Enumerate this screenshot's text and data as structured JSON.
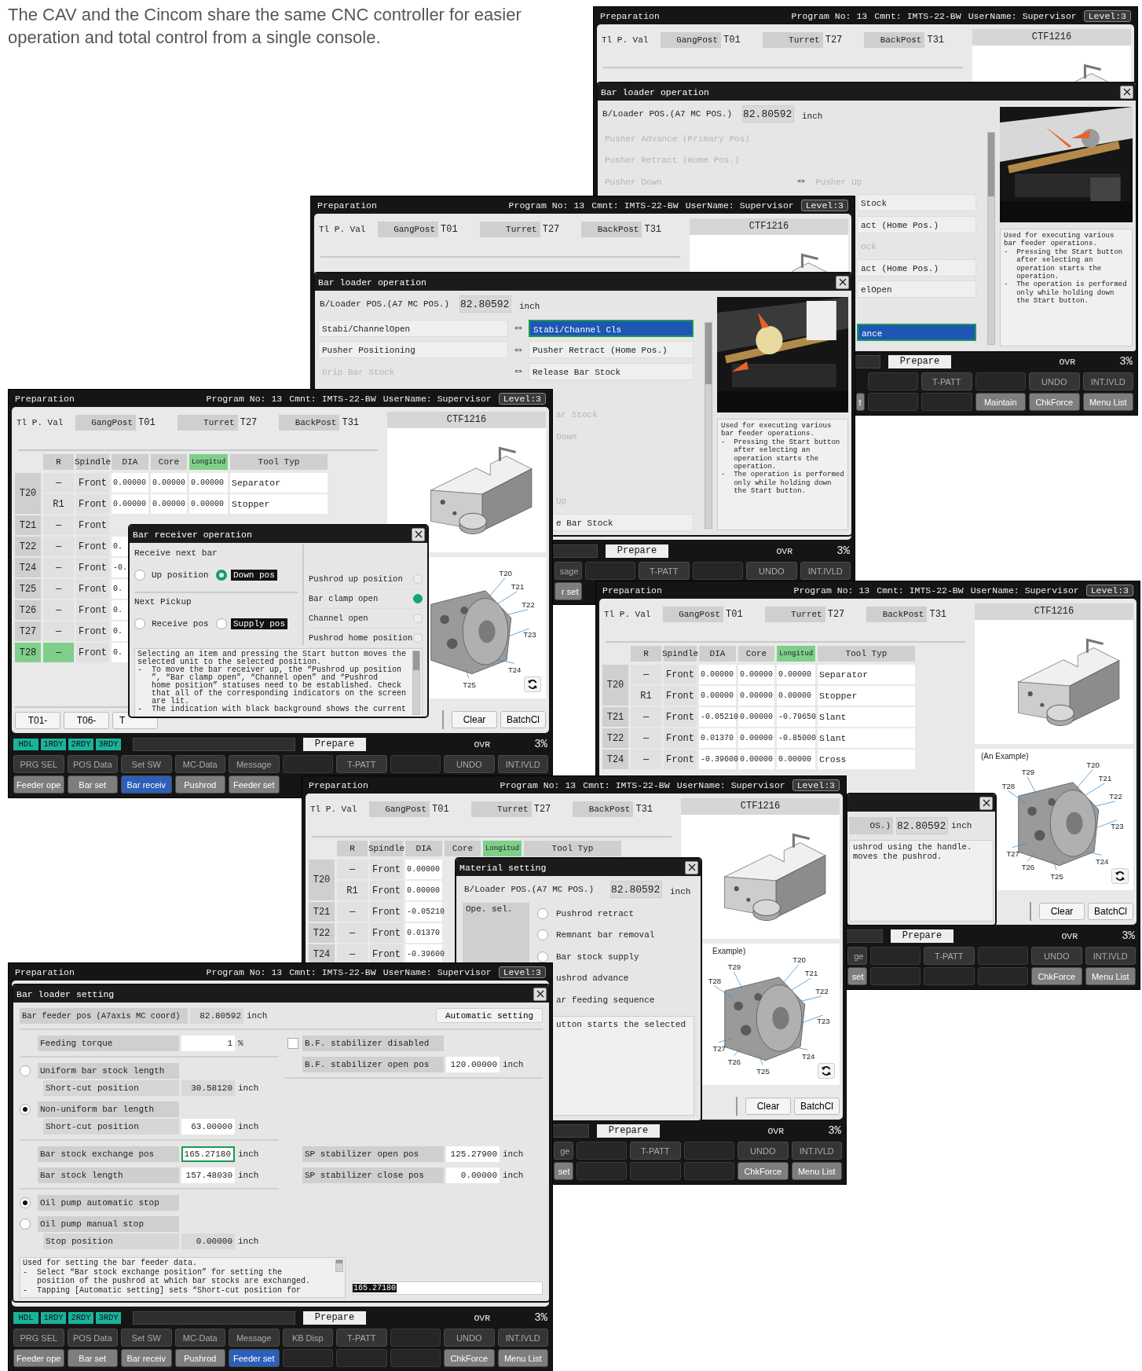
{
  "caption": "The CAV and the Cincom share the same CNC controller for easier operation and total control from a single console.",
  "windows": [
    {
      "header": {
        "title": "Preparation",
        "program": "Program No: 13",
        "comment": "Cmnt: IMTS-22-BW",
        "user": "UserName: Supervisor",
        "level": "Level:3"
      },
      "tabs_label": "Tl P. Val",
      "tabs": [
        {
          "label": "GangPost",
          "value": "T01"
        },
        {
          "label": "Turret",
          "value": "T27"
        },
        {
          "label": "BackPost",
          "value": "T31"
        }
      ],
      "side_panel": {
        "title": "CTF1216"
      },
      "dialog": {
        "kind": "operation",
        "title": "Bar loader operation",
        "position": {
          "label": "B/Loader POS.(A7 MC POS.)",
          "value": "82.80592",
          "unit": "inch"
        },
        "rows": [
          {
            "left": {
              "text": "Pusher Advance (Primary Pos)",
              "selected": false,
              "disabled": true
            }
          },
          {
            "left": {
              "text": "Pusher Retract (Home Pos.)",
              "selected": false,
              "disabled": true
            }
          },
          {
            "left": {
              "text": "Pusher Down",
              "selected": false,
              "disabled": true
            },
            "arrow": "⇔",
            "right": {
              "text": "Pusher Up",
              "selected": false,
              "disabled": true
            }
          },
          {
            "right": {
              "text": "Stock",
              "selected": false,
              "disabled": false
            }
          },
          {
            "right": {
              "text": "act (Home Pos.)",
              "selected": false,
              "disabled": false
            }
          },
          {
            "right": {
              "text": "ock",
              "selected": false,
              "disabled": true
            }
          },
          {
            "right": {
              "text": "act (Home Pos.)",
              "selected": false,
              "disabled": false
            }
          },
          {
            "right": {
              "text": "elOpen",
              "selected": false,
              "disabled": false
            }
          },
          {
            "right": {
              "text": "ance",
              "selected": true,
              "disabled": false
            }
          }
        ],
        "help": "Used for executing various\nbar feeder operations.\n-  Pressing the Start button\n   after selecting an\n   operation starts the\n   operation.\n-  The operation is performed\n   only while holding down\n   the Start button."
      },
      "status": {
        "button": "Prepare",
        "ovr": "OVR",
        "percent": "3%"
      },
      "function_keys": [
        [
          {
            "kind": "blank",
            "selected": false
          },
          {
            "kind": "key",
            "label": "T-PATT",
            "selected": false
          },
          {
            "kind": "blank",
            "selected": false
          },
          {
            "kind": "key",
            "label": "UNDO",
            "selected": false
          },
          {
            "kind": "key",
            "label": "INT.IVLD",
            "selected": false
          }
        ],
        [
          {
            "kind": "cut",
            "label": "t",
            "selected": false
          },
          {
            "kind": "blank",
            "selected": false
          },
          {
            "kind": "blank",
            "selected": false
          },
          {
            "kind": "key",
            "label": "Maintain",
            "selected": false
          },
          {
            "kind": "key",
            "label": "ChkForce",
            "selected": false
          },
          {
            "kind": "key",
            "label": "Menu List",
            "selected": false
          }
        ]
      ]
    },
    {
      "header": {
        "title": "Preparation",
        "program": "Program No: 13",
        "comment": "Cmnt: IMTS-22-BW",
        "user": "UserName: Supervisor",
        "level": "Level:3"
      },
      "tabs_label": "Tl P. Val",
      "tabs": [
        {
          "label": "GangPost",
          "value": "T01"
        },
        {
          "label": "Turret",
          "value": "T27"
        },
        {
          "label": "BackPost",
          "value": "T31"
        }
      ],
      "side_panel": {
        "title": "CTF1216"
      },
      "dialog": {
        "kind": "operation",
        "title": "Bar loader operation",
        "position": {
          "label": "B/Loader POS.(A7 MC POS.)",
          "value": "82.80592",
          "unit": "inch"
        },
        "rows": [
          {
            "left": {
              "text": "Stabi/ChannelOpen",
              "selected": false,
              "disabled": false
            },
            "arrow": "⇔",
            "right": {
              "text": "Stabi/Channel Cls",
              "selected": true,
              "disabled": false
            }
          },
          {
            "left": {
              "text": "Pusher Positioning",
              "selected": false,
              "disabled": false
            },
            "arrow": "⇔",
            "right": {
              "text": "Pusher Retract (Home Pos.)",
              "selected": false,
              "disabled": false
            }
          },
          {
            "left": {
              "text": "Grip Bar Stock",
              "selected": false,
              "disabled": true
            },
            "arrow": "⇔",
            "right": {
              "text": "Release Bar Stock",
              "selected": false,
              "disabled": false
            }
          },
          {
            "right": {
              "text": "ar Stock",
              "selected": false,
              "disabled": true
            }
          },
          {
            "right": {
              "text": "Down",
              "selected": false,
              "disabled": true
            }
          },
          {
            "right": {
              "text": "Up",
              "selected": false,
              "disabled": true
            }
          },
          {
            "right": {
              "text": "e Bar Stock",
              "selected": false,
              "disabled": false
            }
          }
        ],
        "help": "Used for executing various\nbar feeder operations.\n-  Pressing the Start button\n   after selecting an\n   operation starts the\n   operation.\n-  The operation is performed\n   only while holding down\n   the Start button."
      },
      "status": {
        "button": "Prepare",
        "ovr": "OVR",
        "percent": "3%"
      },
      "function_keys": [
        [
          {
            "kind": "cut",
            "label": "sage",
            "selected": false
          },
          {
            "kind": "blank",
            "selected": false
          },
          {
            "kind": "key",
            "label": "T-PATT",
            "selected": false
          },
          {
            "kind": "blank",
            "selected": false
          },
          {
            "kind": "key",
            "label": "UNDO",
            "selected": false
          },
          {
            "kind": "key",
            "label": "INT.IVLD",
            "selected": false
          }
        ],
        [
          {
            "kind": "cut",
            "label": "r set",
            "selected": false
          }
        ]
      ]
    },
    {
      "header": {
        "title": "Preparation",
        "program": "Program No: 13",
        "comment": "Cmnt: IMTS-22-BW",
        "user": "UserName: Supervisor",
        "level": "Level:3"
      },
      "tabs_label": "Tl P. Val",
      "tabs": [
        {
          "label": "GangPost",
          "value": "T01"
        },
        {
          "label": "Turret",
          "value": "T27"
        },
        {
          "label": "BackPost",
          "value": "T31"
        }
      ],
      "table": {
        "columns": [
          {
            "label": "R",
            "selected": false
          },
          {
            "label": "Spindle",
            "selected": false
          },
          {
            "label": "DIA",
            "selected": false
          },
          {
            "label": "Core",
            "selected": false
          },
          {
            "label": "Longitud",
            "selected": true
          },
          {
            "label": "Tool Typ",
            "selected": false
          }
        ],
        "groups": [
          {
            "tool": "T20",
            "selected": false,
            "rows": [
              {
                "cells": [
                  "—",
                  "Front",
                  "0.00000",
                  "0.00000",
                  "0.00000",
                  "Separator"
                ]
              },
              {
                "cells": [
                  "R1",
                  "Front",
                  "0.00000",
                  "0.00000",
                  "0.00000",
                  "Stopper"
                ]
              }
            ]
          },
          {
            "tool": "T21",
            "selected": false,
            "rows": [
              {
                "cells": [
                  "—",
                  "Front"
                ]
              }
            ]
          },
          {
            "tool": "T22",
            "selected": false,
            "rows": [
              {
                "cells": [
                  "—",
                  "Front",
                  "0."
                ]
              }
            ]
          },
          {
            "tool": "T24",
            "selected": false,
            "rows": [
              {
                "cells": [
                  "—",
                  "Front",
                  "-0."
                ]
              }
            ]
          },
          {
            "tool": "T25",
            "selected": false,
            "rows": [
              {
                "cells": [
                  "—",
                  "Front",
                  "0."
                ]
              }
            ]
          },
          {
            "tool": "T26",
            "selected": false,
            "rows": [
              {
                "cells": [
                  "—",
                  "Front",
                  "0."
                ]
              }
            ]
          },
          {
            "tool": "T27",
            "selected": false,
            "rows": [
              {
                "cells": [
                  "—",
                  "Front",
                  "0."
                ]
              }
            ]
          },
          {
            "tool": "T28",
            "selected": true,
            "rows": [
              {
                "cells": [
                  "—",
                  "Front",
                  "0."
                ]
              }
            ]
          }
        ]
      },
      "main_buttons": [
        {
          "kind": "key",
          "label": "T01-"
        },
        {
          "kind": "key",
          "label": "T06-"
        },
        {
          "kind": "cut",
          "label": "T"
        }
      ],
      "side_panel": {
        "title": "CTF1216",
        "turret": {
          "labels": [
            "T20",
            "T21",
            "T22",
            "T23",
            "T24",
            "T25"
          ]
        },
        "buttons": [
          "Clear",
          "BatchCl"
        ]
      },
      "dialog": {
        "kind": "receiver",
        "title": "Bar receiver operation",
        "groups": [
          {
            "title": "Receive next bar",
            "options": [
              {
                "label": "Up position",
                "selected": false,
                "current": false
              },
              {
                "label": "Down pos",
                "selected": true,
                "current": true
              }
            ]
          },
          {
            "title": "Next Pickup",
            "options": [
              {
                "label": "Receive pos",
                "selected": false,
                "current": false
              },
              {
                "label": "Supply pos",
                "selected": false,
                "current": true
              }
            ]
          }
        ],
        "indicators": [
          {
            "label": "Pushrod up position",
            "on": false
          },
          {
            "label": "Bar clamp open",
            "on": true
          },
          {
            "label": "Channel open",
            "on": false
          },
          {
            "label": "Pushrod home position",
            "on": false
          }
        ],
        "help": "Selecting an item and pressing the Start button moves the\nselected unit to the selected position.\n-  To move the bar receiver up, the “Pushrod up position\n   ”, “Bar clamp open”, “Channel open” and “Pushrod\n   home position” statuses need to be established. Check\n   that all of the corresponding indicators on the screen\n   are lit.\n-  The indication with black background shows the current"
      },
      "status": {
        "chips": [
          {
            "label": "HDL",
            "on": true
          },
          {
            "label": "1RDY",
            "on": true
          },
          {
            "label": "2RDY",
            "on": true
          },
          {
            "label": "3RDY",
            "on": true
          }
        ],
        "button": "Prepare",
        "ovr": "OVR",
        "percent": "3%"
      },
      "function_keys": [
        [
          {
            "kind": "key",
            "label": "PRG SEL",
            "selected": false
          },
          {
            "kind": "key",
            "label": "POS Data",
            "selected": false
          },
          {
            "kind": "key",
            "label": "Set SW",
            "selected": false
          },
          {
            "kind": "key",
            "label": "MC-Data",
            "selected": false
          },
          {
            "kind": "key",
            "label": "Message",
            "selected": false
          },
          {
            "kind": "blank",
            "selected": false
          },
          {
            "kind": "key",
            "label": "T-PATT",
            "selected": false
          },
          {
            "kind": "blank",
            "selected": false
          },
          {
            "kind": "key",
            "label": "UNDO",
            "selected": false
          },
          {
            "kind": "key",
            "label": "INT.IVLD",
            "selected": false
          }
        ],
        [
          {
            "kind": "key",
            "label": "Feeder ope",
            "selected": false
          },
          {
            "kind": "key",
            "label": "Bar set",
            "selected": false
          },
          {
            "kind": "key",
            "label": "Bar receiv",
            "selected": true
          },
          {
            "kind": "key",
            "label": "Pushrod",
            "selected": false
          },
          {
            "kind": "key",
            "label": "Feeder set",
            "selected": false
          }
        ]
      ]
    },
    {
      "header": {
        "title": "Preparation",
        "program": "Program No: 13",
        "comment": "Cmnt: IMTS-22-BW",
        "user": "UserName: Supervisor",
        "level": "Level:3"
      },
      "tabs_label": "Tl P. Val",
      "tabs": [
        {
          "label": "GangPost",
          "value": "T01"
        },
        {
          "label": "Turret",
          "value": "T27"
        },
        {
          "label": "BackPost",
          "value": "T31"
        }
      ],
      "table": {
        "columns": [
          {
            "label": "R",
            "selected": false
          },
          {
            "label": "Spindle",
            "selected": false
          },
          {
            "label": "DIA",
            "selected": false
          },
          {
            "label": "Core",
            "selected": false
          },
          {
            "label": "Longitud",
            "selected": true
          },
          {
            "label": "Tool Typ",
            "selected": false
          }
        ],
        "groups": [
          {
            "tool": "T20",
            "selected": false,
            "rows": [
              {
                "cells": [
                  "—",
                  "Front",
                  "0.00000",
                  "0.00000",
                  "0.00000",
                  "Separator"
                ]
              },
              {
                "cells": [
                  "R1",
                  "Front",
                  "0.00000",
                  "0.00000",
                  "0.00000",
                  "Stopper"
                ]
              }
            ]
          },
          {
            "tool": "T21",
            "selected": false,
            "rows": [
              {
                "cells": [
                  "—",
                  "Front",
                  "-0.05210",
                  "0.00000",
                  "-0.79650",
                  "Slant"
                ]
              }
            ]
          },
          {
            "tool": "T22",
            "selected": false,
            "rows": [
              {
                "cells": [
                  "—",
                  "Front",
                  "0.01370",
                  "0.00000",
                  "-0.85000",
                  "Slant"
                ]
              }
            ]
          },
          {
            "tool": "T24",
            "selected": false,
            "rows": [
              {
                "cells": [
                  "—",
                  "Front",
                  "-0.39600",
                  "0.00000",
                  "0.00000",
                  "Cross"
                ]
              }
            ]
          }
        ]
      },
      "side_panel": {
        "title": "CTF1216",
        "caption": "(An Example)",
        "turret": {
          "labels": [
            "T20",
            "T21",
            "T22",
            "T23",
            "T24",
            "T25",
            "T26",
            "T27",
            "T28",
            "T29"
          ]
        },
        "buttons": [
          "Clear",
          "BatchCl"
        ]
      },
      "dialog": {
        "kind": "fragment",
        "position": {
          "label": "OS.)",
          "value": "82.80592",
          "unit": "inch"
        },
        "help": "ushrod using the handle.\nmoves the pushrod."
      },
      "status": {
        "button": "Prepare",
        "ovr": "OVR",
        "percent": "3%"
      },
      "function_keys": [
        [
          {
            "kind": "cut",
            "label": "ge",
            "selected": false
          },
          {
            "kind": "blank",
            "selected": false
          },
          {
            "kind": "key",
            "label": "T-PATT",
            "selected": false
          },
          {
            "kind": "blank",
            "selected": false
          },
          {
            "kind": "key",
            "label": "UNDO",
            "selected": false
          },
          {
            "kind": "key",
            "label": "INT.IVLD",
            "selected": false
          }
        ],
        [
          {
            "kind": "cut",
            "label": "set",
            "selected": false
          },
          {
            "kind": "blank",
            "selected": false
          },
          {
            "kind": "blank",
            "selected": false
          },
          {
            "kind": "blank",
            "selected": false
          },
          {
            "kind": "key",
            "label": "ChkForce",
            "selected": false
          },
          {
            "kind": "key",
            "label": "Menu List",
            "selected": false
          }
        ]
      ]
    },
    {
      "header": {
        "title": "Preparation",
        "program": "Program No: 13",
        "comment": "Cmnt: IMTS-22-BW",
        "user": "UserName: Supervisor",
        "level": "Level:3"
      },
      "tabs_label": "Tl P. Val",
      "tabs": [
        {
          "label": "GangPost",
          "value": "T01"
        },
        {
          "label": "Turret",
          "value": "T27"
        },
        {
          "label": "BackPost",
          "value": "T31"
        }
      ],
      "table": {
        "columns": [
          {
            "label": "R",
            "selected": false
          },
          {
            "label": "Spindle",
            "selected": false
          },
          {
            "label": "DIA",
            "selected": false
          },
          {
            "label": "Core",
            "selected": false
          },
          {
            "label": "Longitud",
            "selected": true
          },
          {
            "label": "Tool Typ",
            "selected": false
          }
        ],
        "groups": [
          {
            "tool": "T20",
            "selected": false,
            "rows": [
              {
                "cells": [
                  "—",
                  "Front",
                  "0.00000"
                ]
              },
              {
                "cells": [
                  "R1",
                  "Front",
                  "0.00000"
                ]
              }
            ]
          },
          {
            "tool": "T21",
            "selected": false,
            "rows": [
              {
                "cells": [
                  "—",
                  "Front",
                  "-0.05210"
                ]
              }
            ]
          },
          {
            "tool": "T22",
            "selected": false,
            "rows": [
              {
                "cells": [
                  "—",
                  "Front",
                  "0.01370"
                ]
              }
            ]
          },
          {
            "tool": "T24",
            "selected": false,
            "rows": [
              {
                "cells": [
                  "—",
                  "Front",
                  "-0.39600"
                ]
              }
            ]
          }
        ]
      },
      "side_panel": {
        "title": "CTF1216",
        "caption": "Example)",
        "turret": {
          "labels": [
            "T20",
            "T21",
            "T22",
            "T23",
            "T24",
            "T25",
            "T26",
            "T27",
            "T28",
            "T29"
          ]
        },
        "buttons": [
          "Clear",
          "BatchCl"
        ]
      },
      "dialog": {
        "kind": "material",
        "title": "Material setting",
        "position": {
          "label": "B/Loader POS.(A7 MC POS.)",
          "value": "82.80592",
          "unit": "inch"
        },
        "panel": "Ope. sel.",
        "options": [
          {
            "kind": "radio",
            "label": "Pushrod retract",
            "selected": false
          },
          {
            "kind": "radio",
            "label": "Remnant bar removal",
            "selected": false
          },
          {
            "kind": "radio",
            "label": "Bar stock supply",
            "selected": false
          },
          {
            "kind": "cut",
            "label": "ushrod advance"
          },
          {
            "kind": "cut",
            "label": "ar feeding sequence"
          }
        ],
        "help": "utton starts the selected"
      },
      "status": {
        "button": "Prepare",
        "ovr": "OVR",
        "percent": "3%"
      },
      "function_keys": [
        [
          {
            "kind": "cut",
            "label": "ge",
            "selected": false
          },
          {
            "kind": "blank",
            "selected": false
          },
          {
            "kind": "key",
            "label": "T-PATT",
            "selected": false
          },
          {
            "kind": "blank",
            "selected": false
          },
          {
            "kind": "key",
            "label": "UNDO",
            "selected": false
          },
          {
            "kind": "key",
            "label": "INT.IVLD",
            "selected": false
          }
        ],
        [
          {
            "kind": "cut",
            "label": "set",
            "selected": false
          },
          {
            "kind": "blank",
            "selected": false
          },
          {
            "kind": "blank",
            "selected": false
          },
          {
            "kind": "blank",
            "selected": false
          },
          {
            "kind": "key",
            "label": "ChkForce",
            "selected": false
          },
          {
            "kind": "key",
            "label": "Menu List",
            "selected": false
          }
        ]
      ]
    },
    {
      "header": {
        "title": "Preparation",
        "program": "Program No: 13",
        "comment": "Cmnt: IMTS-22-BW",
        "user": "UserName: Supervisor",
        "level": "Level:3"
      },
      "dialog": {
        "kind": "setting",
        "title": "Bar loader setting",
        "position": {
          "label": "Bar feeder pos (A7axis MC coord)",
          "value": "82.80592",
          "unit": "inch"
        },
        "auto_button": "Automatic setting",
        "left": [
          {
            "items": [
              {
                "kind": "field",
                "label": "Feeding torque",
                "value": "1",
                "unit": "%",
                "readonly": false,
                "focused": false
              }
            ]
          },
          {
            "items": [
              {
                "kind": "radio",
                "label": "Uniform bar stock length",
                "selected": false
              },
              {
                "kind": "sub",
                "label": "Short-cut position",
                "value": "30.58120",
                "unit": "inch",
                "readonly": true,
                "focused": false
              },
              {
                "kind": "radio",
                "label": "Non-uniform bar length",
                "selected": true
              },
              {
                "kind": "sub",
                "label": "Short-cut position",
                "value": "63.00000",
                "unit": "inch",
                "readonly": false,
                "focused": false
              }
            ]
          },
          {
            "items": [
              {
                "kind": "field",
                "label": "Bar stock exchange pos",
                "value": "165.27180",
                "unit": "inch",
                "readonly": false,
                "focused": true
              },
              {
                "kind": "field",
                "label": "Bar stock length",
                "value": "157.48030",
                "unit": "inch",
                "readonly": false,
                "focused": false
              }
            ]
          },
          {
            "items": [
              {
                "kind": "radio",
                "label": "Oil pump automatic stop",
                "selected": true
              },
              {
                "kind": "radio",
                "label": "Oil pump manual stop",
                "selected": false
              },
              {
                "kind": "sub",
                "label": "Stop position",
                "value": "0.00000",
                "unit": "inch",
                "readonly": true,
                "focused": false
              }
            ]
          }
        ],
        "right": [
          {
            "items": [
              {
                "kind": "checkbox",
                "label": "B.F. stabilizer disabled",
                "checked": false
              },
              {
                "kind": "field",
                "label": "B.F. stabilizer open pos",
                "value": "120.00000",
                "unit": "inch",
                "readonly": false,
                "focused": false
              }
            ]
          },
          {
            "items": [
              {
                "kind": "field",
                "label": "SP stabilizer open pos",
                "value": "125.27900",
                "unit": "inch",
                "readonly": false,
                "focused": false
              },
              {
                "kind": "field",
                "label": "SP stabilizer close pos",
                "value": "0.00000",
                "unit": "inch",
                "readonly": false,
                "focused": false
              }
            ]
          }
        ],
        "help": "Used for setting the bar feeder data.\n-  Select “Bar stock exchange position” for setting the\n   position of the pushrod at which bar stocks are exchanged.\n-  Tapping [Automatic setting] sets “Short-cut position for",
        "input": "165.27180"
      },
      "status": {
        "chips": [
          {
            "label": "HDL",
            "on": true
          },
          {
            "label": "1RDY",
            "on": true
          },
          {
            "label": "2RDY",
            "on": true
          },
          {
            "label": "3RDY",
            "on": true
          }
        ],
        "button": "Prepare",
        "ovr": "OVR",
        "percent": "3%"
      },
      "function_keys": [
        [
          {
            "kind": "key",
            "label": "PRG SEL",
            "selected": false
          },
          {
            "kind": "key",
            "label": "POS Data",
            "selected": false
          },
          {
            "kind": "key",
            "label": "Set SW",
            "selected": false
          },
          {
            "kind": "key",
            "label": "MC-Data",
            "selected": false
          },
          {
            "kind": "key",
            "label": "Message",
            "selected": false
          },
          {
            "kind": "key",
            "label": "KB Disp",
            "selected": false
          },
          {
            "kind": "key",
            "label": "T-PATT",
            "selected": false
          },
          {
            "kind": "blank",
            "selected": false
          },
          {
            "kind": "key",
            "label": "UNDO",
            "selected": false
          },
          {
            "kind": "key",
            "label": "INT.IVLD",
            "selected": false
          }
        ],
        [
          {
            "kind": "key",
            "label": "Feeder ope",
            "selected": false
          },
          {
            "kind": "key",
            "label": "Bar set",
            "selected": false
          },
          {
            "kind": "key",
            "label": "Bar receiv",
            "selected": false
          },
          {
            "kind": "key",
            "label": "Pushrod",
            "selected": false
          },
          {
            "kind": "key",
            "label": "Feeder set",
            "selected": true
          },
          {
            "kind": "blank",
            "selected": false
          },
          {
            "kind": "blank",
            "selected": false
          },
          {
            "kind": "blank",
            "selected": false
          },
          {
            "kind": "key",
            "label": "ChkForce",
            "selected": false
          },
          {
            "kind": "key",
            "label": "Menu List",
            "selected": false
          }
        ]
      ]
    }
  ]
}
